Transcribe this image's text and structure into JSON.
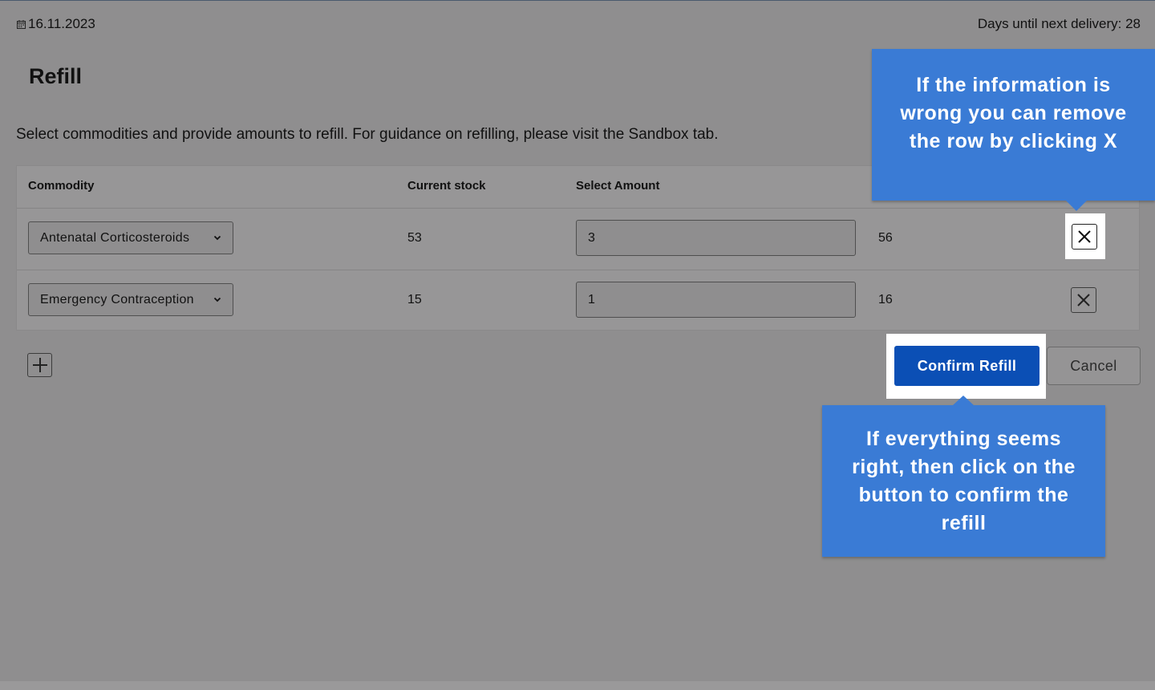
{
  "header": {
    "date": "16.11.2023",
    "days_until_delivery": "Days until next delivery: 28"
  },
  "page": {
    "title": "Refill",
    "description": "Select commodities and provide amounts to refill. For guidance on refilling, please visit the Sandbox tab."
  },
  "table": {
    "columns": [
      "Commodity",
      "Current stock",
      "Select Amount"
    ],
    "rows": [
      {
        "commodity": "Antenatal Corticosteroids",
        "current_stock": "53",
        "amount": "3",
        "new_total": "56"
      },
      {
        "commodity": "Emergency Contraception",
        "current_stock": "15",
        "amount": "1",
        "new_total": "16"
      }
    ]
  },
  "actions": {
    "confirm": "Confirm Refill",
    "cancel": "Cancel"
  },
  "tooltips": {
    "remove_row": "If the information is wrong you can remove the row by clicking X",
    "confirm": "If everything seems right, then click on the button to confirm the refill"
  },
  "colors": {
    "overlay_background": "#8f8e8f",
    "primary_button": "#0b4fb5",
    "tooltip": "#3a7bd5"
  },
  "icons": [
    "calendar-icon",
    "chevron-down-icon",
    "close-icon",
    "plus-icon"
  ]
}
